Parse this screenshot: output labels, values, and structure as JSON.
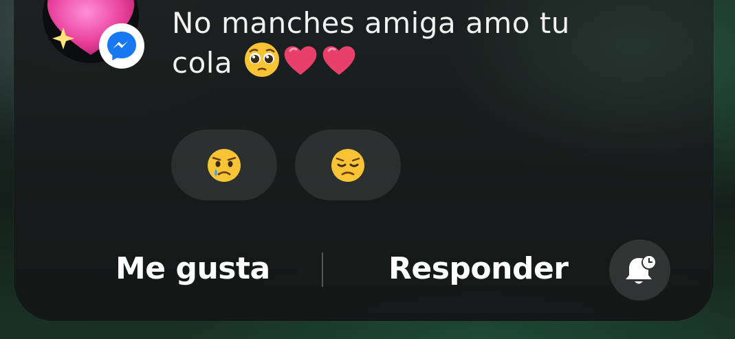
{
  "notification": {
    "message_line1": "No manches amiga amo tu",
    "message_line2": "cola",
    "message_emojis": [
      "pleading-face-emoji",
      "red-heart-emoji",
      "red-heart-emoji"
    ],
    "avatar_icon": "sparkling-heart-emoji",
    "app_badge_icon": "messenger-icon"
  },
  "reactions": [
    {
      "icon": "crying-face-emoji"
    },
    {
      "icon": "disappointed-face-emoji"
    }
  ],
  "actions": {
    "like_label": "Me gusta",
    "reply_label": "Responder",
    "snooze_icon": "bell-snooze-icon"
  },
  "colors": {
    "messenger_blue": "#1877F2",
    "heart_pink": "#E8406A",
    "text": "#F2F2F2"
  }
}
